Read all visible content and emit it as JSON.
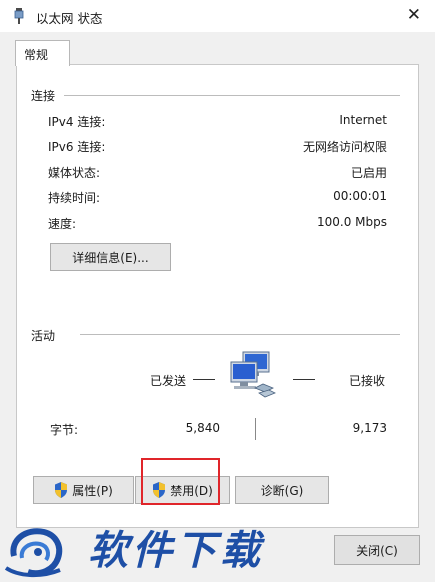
{
  "window": {
    "title": "以太网 状态",
    "close_glyph": "✕"
  },
  "tabs": [
    {
      "label": "常规",
      "active": true
    }
  ],
  "connection": {
    "group_label": "连接",
    "rows": [
      {
        "label": "IPv4 连接:",
        "value": "Internet"
      },
      {
        "label": "IPv6 连接:",
        "value": "无网络访问权限"
      },
      {
        "label": "媒体状态:",
        "value": "已启用"
      },
      {
        "label": "持续时间:",
        "value": "00:00:01"
      },
      {
        "label": "速度:",
        "value": "100.0 Mbps"
      }
    ],
    "details_button": "详细信息(E)..."
  },
  "activity": {
    "group_label": "活动",
    "sent_label": "已发送",
    "received_label": "已接收",
    "bytes_label": "字节:",
    "bytes_sent": "5,840",
    "bytes_received": "9,173",
    "icon": "network-computers-icon"
  },
  "buttons": {
    "properties": "属性(P)",
    "disable": "禁用(D)",
    "diagnose": "诊断(G)",
    "close": "关闭(C)"
  },
  "watermark": {
    "text": "软件下载"
  },
  "colors": {
    "highlight_border": "#e0252a",
    "watermark_blue": "#1e4fa6",
    "shield_blue": "#2a66c8",
    "shield_yellow": "#f2c12e"
  }
}
